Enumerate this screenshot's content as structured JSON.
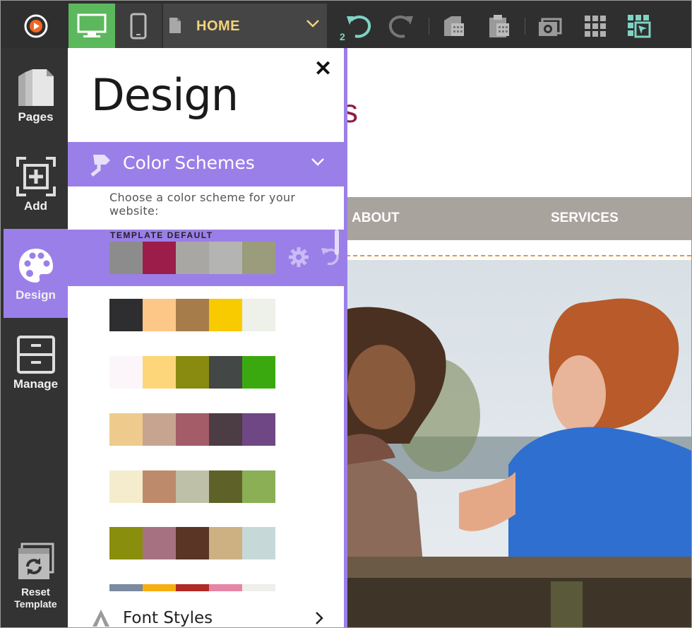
{
  "toolbar": {
    "page_label": "HOME",
    "undo_count": "2"
  },
  "sidebar": {
    "items": [
      {
        "label": "Pages"
      },
      {
        "label": "Add"
      },
      {
        "label": "Design"
      },
      {
        "label": "Manage"
      }
    ],
    "reset_line1": "Reset",
    "reset_line2": "Template"
  },
  "panel": {
    "title": "Design",
    "section_title": "Color Schemes",
    "description": "Choose a color scheme for your website:",
    "selected_label": "TEMPLATE DEFAULT",
    "font_section": "Font Styles"
  },
  "schemes": [
    [
      "#8c8c8c",
      "#9c1c4a",
      "#a9a7a3",
      "#b4b4b2",
      "#9a9c7c"
    ],
    [
      "#2e2e30",
      "#fdc788",
      "#a67c4a",
      "#f8cb00",
      "#eef0ea"
    ],
    [
      "#fcf6fb",
      "#fdd67a",
      "#888b0f",
      "#434745",
      "#3aa90f"
    ],
    [
      "#eecb8d",
      "#c6a48f",
      "#a35c68",
      "#4c3c44",
      "#6e4784"
    ],
    [
      "#f4eccc",
      "#bd8b6b",
      "#bec0a8",
      "#5e6228",
      "#8aaf55"
    ],
    [
      "#8a8e0d",
      "#a67282",
      "#5a3424",
      "#cdb183",
      "#c7d8d8"
    ],
    [
      "#7a8aa0",
      "#f6ae10",
      "#b22a25",
      "#e586a6",
      "#eeeeea"
    ]
  ],
  "preview": {
    "title_fragment": "s",
    "nav_about": "ABOUT",
    "nav_services": "SERVICES"
  },
  "colors": {
    "accent": "#9b7fe8",
    "toolbar_bg": "#2f2f2f",
    "sidebar_bg": "#333333",
    "active_green": "#5cb85c",
    "page_label": "#f2d37a",
    "title_color": "#8f1c47"
  }
}
